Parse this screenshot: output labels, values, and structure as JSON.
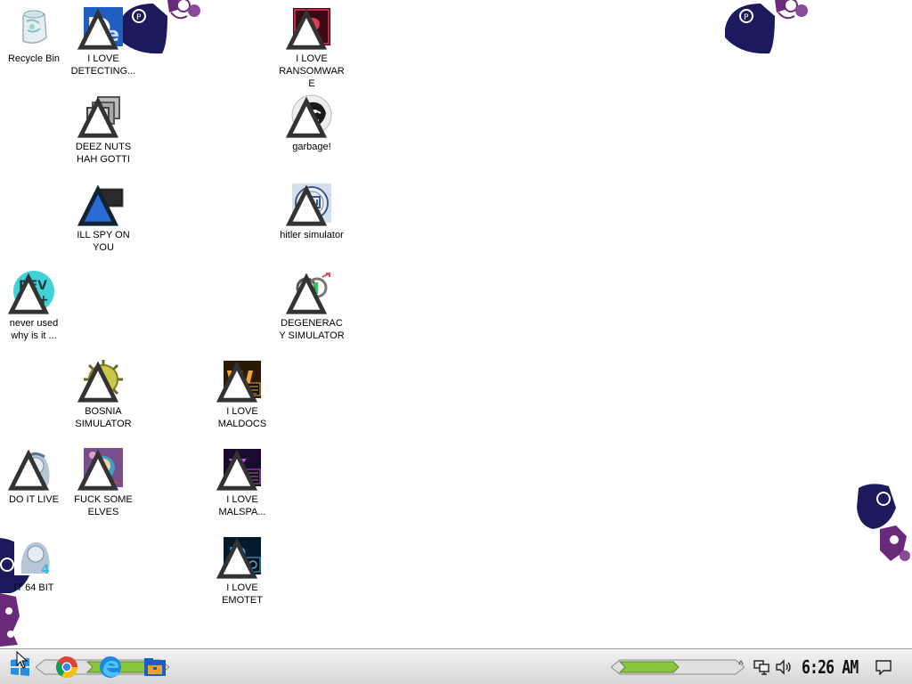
{
  "desktop": {
    "icons": [
      {
        "label": "Recycle Bin",
        "icon": "recycle-bin-icon"
      },
      {
        "label": "I LOVE DETECTING...",
        "icon": "detect-it-easy-icon"
      },
      {
        "label": "I LOVE RANSOMWARE",
        "icon": "ransomware-p-icon"
      },
      {
        "label": "DEEZ NUTS HAH GOTTI",
        "icon": "stacked-windows-icon"
      },
      {
        "label": "garbage!",
        "icon": "lion-emblem-icon"
      },
      {
        "label": "ILL SPY ON YOU",
        "icon": "spy-camera-icon"
      },
      {
        "label": "hitler simulator",
        "icon": "seal-emblem-icon"
      },
      {
        "label": "never used why is it ...",
        "icon": "dev-cpp-icon"
      },
      {
        "label": "DEGENERACY SIMULATOR",
        "icon": "gender-symbol-icon"
      },
      {
        "label": "BOSNIA SIMULATOR",
        "icon": "spiked-mine-icon"
      },
      {
        "label": "I LOVE MALDOCS",
        "icon": "word-doc-icon"
      },
      {
        "label": "DO IT LIVE",
        "icon": "portrait-icon"
      },
      {
        "label": "FUCK SOME ELVES",
        "icon": "game-art-icon"
      },
      {
        "label": "I LOVE MALSPA...",
        "icon": "excel-doc-icon"
      },
      {
        "label": "IT 64 BIT",
        "icon": "portrait-64-icon"
      },
      {
        "label": "I LOVE EMOTET",
        "icon": "publisher-doc-icon"
      }
    ]
  },
  "taskbar": {
    "start": {
      "icon": "start-windows-icon"
    },
    "pinned": [
      {
        "icon": "chrome-icon"
      },
      {
        "icon": "edge-browser-icon"
      },
      {
        "icon": "file-explorer-icon"
      }
    ],
    "tray": {
      "chevron": "^",
      "network_icon": "network-icon",
      "volume_icon": "volume-icon",
      "clock": "6:26 AM",
      "notification_icon": "notification-icon"
    }
  },
  "colors": {
    "taskbar_top": "#f3f3f3",
    "taskbar_bottom": "#d6d6d6",
    "deco_navy": "#1c1a5c",
    "deco_purple": "#6a2a7a",
    "progress_green": "#8cc63f"
  }
}
